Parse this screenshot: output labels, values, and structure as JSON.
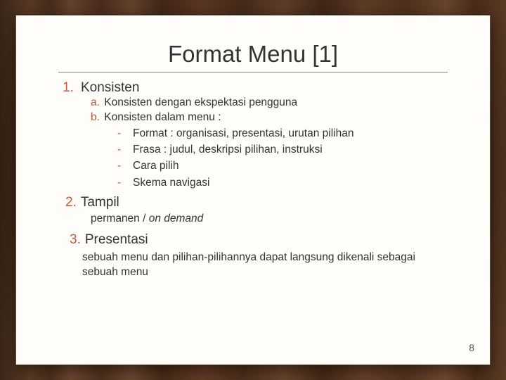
{
  "title": "Format Menu [1]",
  "sections": [
    {
      "ord": "1.",
      "heading": "Konsisten",
      "subs": [
        {
          "label": "a.",
          "text": "Konsisten dengan ekspektasi pengguna"
        },
        {
          "label": "b.",
          "text": "Konsisten dalam menu :"
        }
      ],
      "dashes": [
        "Format : organisasi, presentasi, urutan pilihan",
        "Frasa : judul, deskripsi pilihan, instruksi",
        "Cara pilih",
        "Skema navigasi"
      ]
    },
    {
      "ord": "2.",
      "heading": "Tampil",
      "body_plain": "permanen / ",
      "body_italic": "on demand"
    },
    {
      "ord": "3.",
      "heading": "Presentasi",
      "body": "sebuah menu dan pilihan-pilihannya dapat langsung dikenali  sebagai sebuah menu"
    }
  ],
  "page_number": "8"
}
